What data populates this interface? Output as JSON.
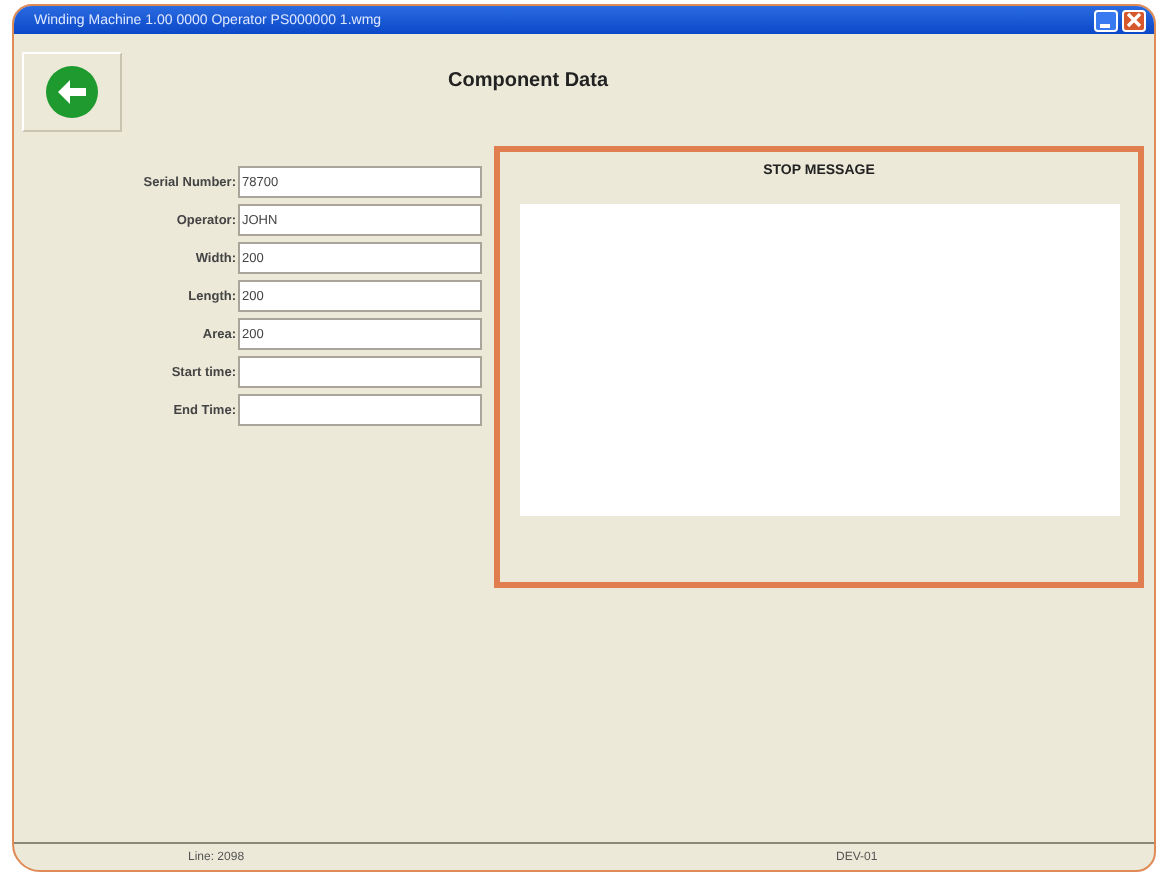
{
  "window": {
    "title": "Winding Machine 1.00 0000 Operator PS000000 1.wmg"
  },
  "header": {
    "title": "Component Data"
  },
  "fields": [
    {
      "label": "Serial Number:",
      "value": "78700"
    },
    {
      "label": "Operator:",
      "value": "JOHN"
    },
    {
      "label": "Width:",
      "value": "200"
    },
    {
      "label": "Length:",
      "value": "200"
    },
    {
      "label": "Area:",
      "value": "200"
    },
    {
      "label": "Start time:"
    },
    {
      "label": "End Time:"
    }
  ],
  "stop_message": {
    "title": "STOP MESSAGE"
  },
  "status_bar": [
    "Line: 2098",
    "DEV-01"
  ]
}
